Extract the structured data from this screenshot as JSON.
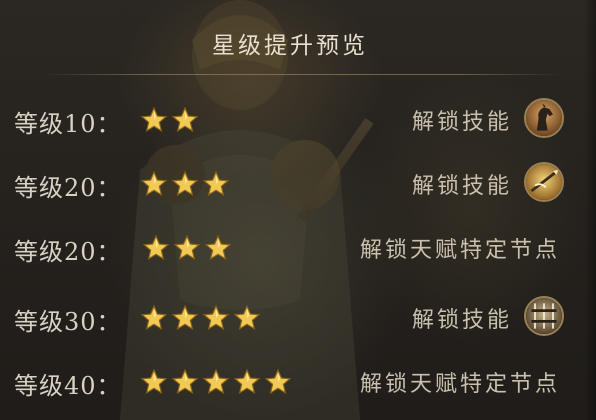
{
  "panel": {
    "title": "星级提升预览"
  },
  "rows": [
    {
      "level_label": "等级10：",
      "stars": 2,
      "reward": "解锁技能",
      "icon": "horse-skill-icon"
    },
    {
      "level_label": "等级20：",
      "stars": 3,
      "reward": "解锁技能",
      "icon": "spear-skill-icon"
    },
    {
      "level_label": "等级20：",
      "stars": 3,
      "reward": "解锁天赋特定节点",
      "icon": ""
    },
    {
      "level_label": "等级30：",
      "stars": 4,
      "reward": "解锁技能",
      "icon": "weapon-rack-skill-icon"
    },
    {
      "level_label": "等级40：",
      "stars": 5,
      "reward": "解锁天赋特定节点",
      "icon": ""
    }
  ],
  "colors": {
    "star_gold": "#f3c955",
    "text": "#d8d1c4",
    "icon_border": "#9a8153"
  }
}
